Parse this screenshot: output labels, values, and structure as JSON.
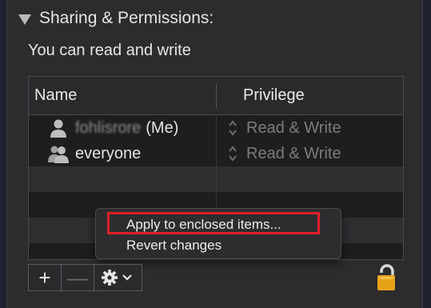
{
  "section": {
    "title": "Sharing & Permissions:"
  },
  "subtitle": "You can read and write",
  "table": {
    "columns": [
      "Name",
      "Privilege"
    ],
    "rows": [
      {
        "name_blurred": "fohlisrore",
        "name_suffix": "(Me)",
        "privilege": "Read & Write",
        "icon": "single-user-icon"
      },
      {
        "name": "everyone",
        "privilege": "Read & Write",
        "icon": "group-users-icon"
      }
    ]
  },
  "context_menu": {
    "items": [
      {
        "label": "Apply to enclosed items..."
      },
      {
        "label": "Revert changes"
      }
    ]
  },
  "toolbar": {
    "add_label": "+",
    "remove_label": "—"
  }
}
